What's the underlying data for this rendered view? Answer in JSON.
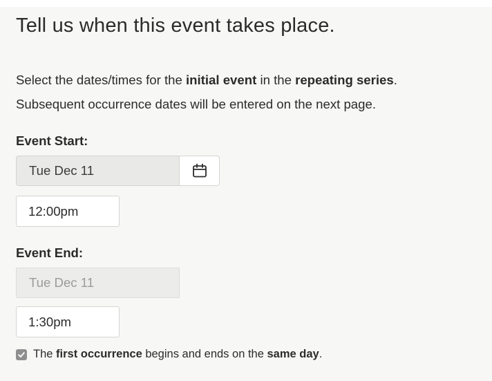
{
  "heading": "Tell us when this event takes place.",
  "instructions": {
    "line1_pre": "Select the dates/times for the ",
    "line1_bold1": "initial event",
    "line1_mid": " in the ",
    "line1_bold2": "repeating series",
    "line1_post": ".",
    "line2": "Subsequent occurrence dates will be entered on the next page."
  },
  "event_start": {
    "label": "Event Start:",
    "date": "Tue Dec 11",
    "calendar_icon": "calendar-icon",
    "time": "12:00pm"
  },
  "event_end": {
    "label": "Event End:",
    "date": "Tue Dec 11",
    "time": "1:30pm"
  },
  "same_day": {
    "checked": true,
    "text_pre": "The ",
    "text_bold1": "first occurrence",
    "text_mid": " begins and ends on the ",
    "text_bold2": "same day",
    "text_post": "."
  },
  "colors": {
    "panel_bg": "#f7f7f6",
    "text": "#2b2b2b",
    "disabled_text": "#9b9b9b",
    "checkbox_fill": "#8e8e8e"
  }
}
